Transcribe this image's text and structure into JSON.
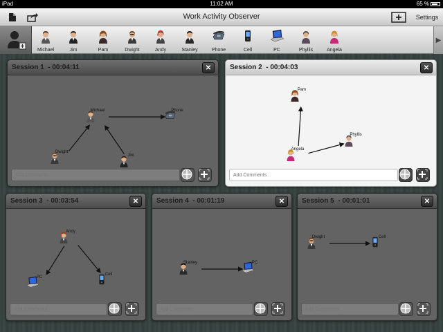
{
  "status_bar": {
    "device": "iPad",
    "time": "11:02 AM",
    "battery": "65 %"
  },
  "title_bar": {
    "title": "Work Activity Observer",
    "settings_label": "Settings"
  },
  "people": [
    {
      "label": "Michael",
      "icon": "man-suit-icon"
    },
    {
      "label": "Jim",
      "icon": "man-dark-suit-icon"
    },
    {
      "label": "Pam",
      "icon": "woman-icon"
    },
    {
      "label": "Dwight",
      "icon": "man-glasses-icon"
    },
    {
      "label": "Andy",
      "icon": "man-headset-icon"
    },
    {
      "label": "Stanley",
      "icon": "man-suit-dark-icon"
    },
    {
      "label": "Phone",
      "icon": "phone-icon"
    },
    {
      "label": "Cell",
      "icon": "cell-phone-icon"
    },
    {
      "label": "PC",
      "icon": "laptop-icon"
    },
    {
      "label": "Phyllis",
      "icon": "woman-older-icon"
    },
    {
      "label": "Angela",
      "icon": "woman-pink-icon"
    }
  ],
  "comment_placeholder": "Add Comments",
  "sessions": [
    {
      "title": "Session 1  - 00:04:11",
      "active": false,
      "nodes": [
        {
          "label": "Michael",
          "icon": "man-suit-icon"
        },
        {
          "label": "Phone",
          "icon": "phone-icon"
        },
        {
          "label": "Dwight",
          "icon": "man-glasses-icon"
        },
        {
          "label": "Jim",
          "icon": "man-dark-suit-icon"
        }
      ]
    },
    {
      "title": "Session 2  - 00:04:03",
      "active": true,
      "nodes": [
        {
          "label": "Pam",
          "icon": "woman-icon"
        },
        {
          "label": "Phyllis",
          "icon": "woman-older-icon"
        },
        {
          "label": "Angela",
          "icon": "woman-pink-icon"
        }
      ]
    },
    {
      "title": "Session 3  - 00:03:54",
      "active": false,
      "nodes": [
        {
          "label": "Andy",
          "icon": "man-headset-icon"
        },
        {
          "label": "PC",
          "icon": "laptop-icon"
        },
        {
          "label": "Cell",
          "icon": "cell-phone-icon"
        }
      ]
    },
    {
      "title": "Session 4  - 00:01:19",
      "active": false,
      "nodes": [
        {
          "label": "Stanley",
          "icon": "man-suit-dark-icon"
        },
        {
          "label": "PC",
          "icon": "laptop-icon"
        }
      ]
    },
    {
      "title": "Session 5  - 00:01:01",
      "active": false,
      "nodes": [
        {
          "label": "Dwight",
          "icon": "man-glasses-icon"
        },
        {
          "label": "Cell",
          "icon": "cell-phone-icon"
        }
      ]
    }
  ]
}
